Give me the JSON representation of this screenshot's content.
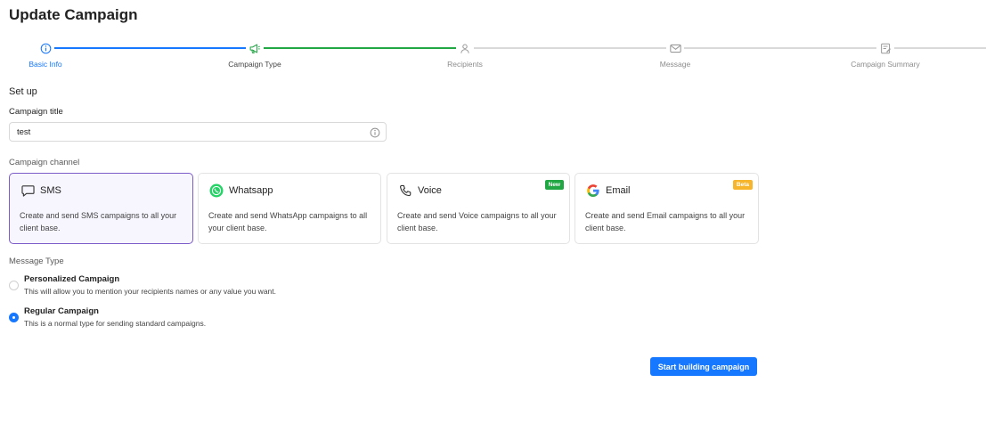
{
  "page": {
    "title": "Update Campaign"
  },
  "stepper": {
    "steps": [
      {
        "label": "Basic Info",
        "icon": "info-circle-icon",
        "state": "active"
      },
      {
        "label": "Campaign Type",
        "icon": "megaphone-icon",
        "state": "done"
      },
      {
        "label": "Recipients",
        "icon": "user-icon",
        "state": "pending"
      },
      {
        "label": "Message",
        "icon": "envelope-icon",
        "state": "pending"
      },
      {
        "label": "Campaign Summary",
        "icon": "summary-icon",
        "state": "pending"
      }
    ]
  },
  "setup": {
    "section_title": "Set up",
    "title_label": "Campaign title",
    "title_value": "test"
  },
  "channels": {
    "label": "Campaign channel",
    "items": [
      {
        "name": "SMS",
        "icon": "chat-bubble-icon",
        "description": "Create and send SMS campaigns to all your client base.",
        "selected": true,
        "badge": ""
      },
      {
        "name": "Whatsapp",
        "icon": "whatsapp-icon",
        "description": "Create and send WhatsApp campaigns to all your client base.",
        "selected": false,
        "badge": ""
      },
      {
        "name": "Voice",
        "icon": "phone-icon",
        "description": "Create and send Voice campaigns to all your client base.",
        "selected": false,
        "badge": "New"
      },
      {
        "name": "Email",
        "icon": "google-icon",
        "description": "Create and send Email campaigns to all your client base.",
        "selected": false,
        "badge": "Beta"
      }
    ]
  },
  "message_type": {
    "label": "Message Type",
    "options": [
      {
        "title": "Personalized Campaign",
        "description": "This will allow you to mention your recipients names or any value you want.",
        "checked": false
      },
      {
        "title": "Regular Campaign",
        "description": "This is a normal type for sending standard campaigns.",
        "checked": true
      }
    ]
  },
  "actions": {
    "primary_label": "Start building campaign"
  },
  "colors": {
    "primary": "#1677ff",
    "progress": "#22a745",
    "selected_border": "#7c5cc9",
    "new_badge": "#22a745",
    "beta_badge": "#f7b52b"
  }
}
